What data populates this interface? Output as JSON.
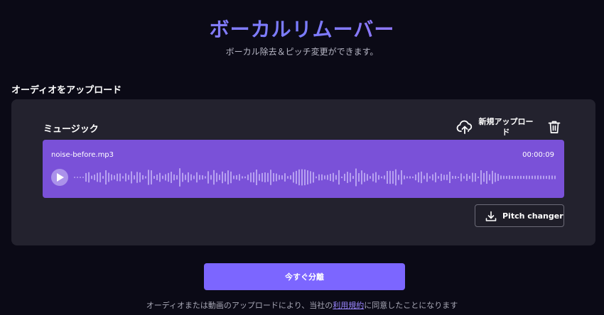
{
  "header": {
    "title": "ボーカルリムーバー",
    "subtitle": "ボーカル除去＆ピッチ変更ができます。"
  },
  "upload_section": {
    "label": "オーディオをアップロード"
  },
  "panel": {
    "music_label": "ミュージック",
    "new_upload_label": "新規アップロード",
    "upload_icon": "cloud-upload-icon",
    "delete_icon": "trash-icon"
  },
  "audio": {
    "file_name": "noise-before.mp3",
    "duration": "00:00:09",
    "play_icon": "play-icon"
  },
  "pitch_button": {
    "label": "Pitch changer",
    "icon": "download-icon"
  },
  "cta": {
    "label": "今すぐ分離"
  },
  "footer": {
    "text_before": "オーディオまたは動画のアップロードにより、当社の",
    "link": "利用規約",
    "text_after": "に同意したことになります"
  },
  "colors": {
    "background": "#0b0a16",
    "panel": "#23222e",
    "audio_card": "#7a51d8",
    "cta": "#7c66ff",
    "link": "#9b87ff"
  }
}
